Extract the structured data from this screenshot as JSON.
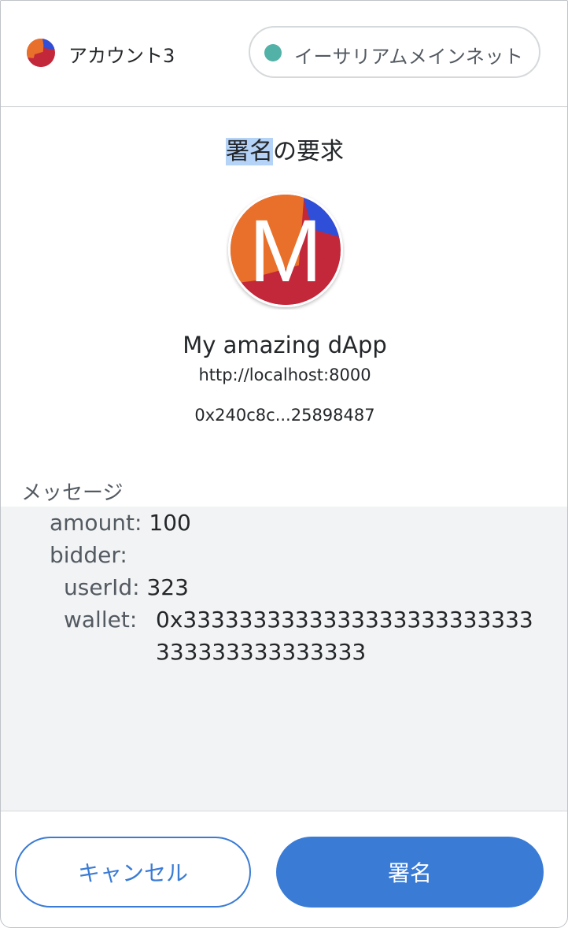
{
  "header": {
    "account_name": "アカウント3",
    "network_label": "イーサリアムメインネット",
    "network_color": "#53b2a7"
  },
  "title": {
    "highlighted": "署名",
    "rest": "の要求"
  },
  "site": {
    "icon_letter": "M",
    "name": "My amazing dApp",
    "origin": "http://localhost:8000",
    "address": "0x240c8c...25898487"
  },
  "message": {
    "label": "メッセージ",
    "amount_key": "amount:",
    "amount_value": "100",
    "bidder_key": "bidder:",
    "userId_key": "userId:",
    "userId_value": "323",
    "wallet_key": "wallet:",
    "wallet_value_line1": "0x3333333333333333333333333",
    "wallet_value_line2": "333333333333333"
  },
  "buttons": {
    "cancel": "キャンセル",
    "sign": "署名"
  },
  "colors": {
    "primary": "#3a7bd5",
    "orange": "#e8702a",
    "red": "#c3273a",
    "blue": "#2f4fd8"
  }
}
